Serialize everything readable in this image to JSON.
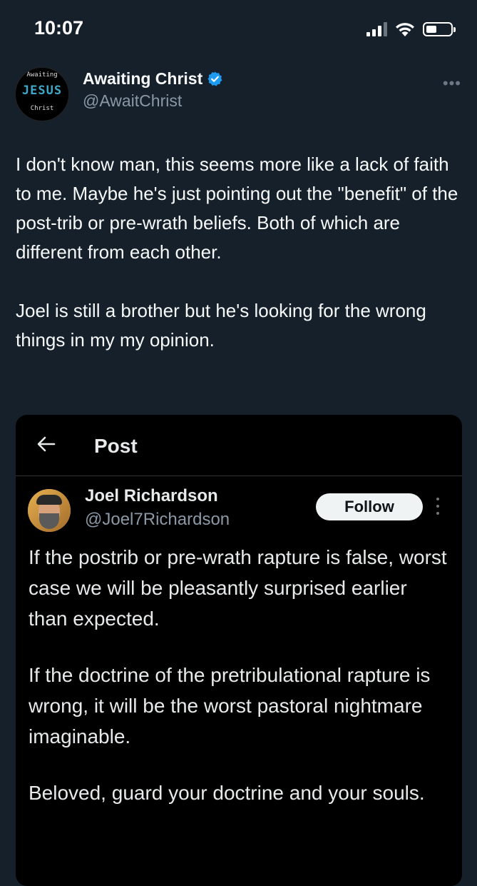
{
  "status_bar": {
    "time": "10:07"
  },
  "tweet": {
    "author_name": "Awaiting Christ",
    "author_handle": "@AwaitChrist",
    "avatar_text": {
      "top": "Awaiting",
      "middle": "JESUS",
      "bottom": "Christ"
    },
    "paragraphs": [
      "I don't know man, this seems more like a lack of faith to me. Maybe he's just pointing out the \"benefit\" of the post-trib or pre-wrath beliefs. Both of which are different from each other.",
      "Joel is still a brother but he's looking for the wrong things in my my opinion."
    ]
  },
  "embedded_screenshot": {
    "title": "Post",
    "author_name": "Joel Richardson",
    "author_handle": "@Joel7Richardson",
    "follow_label": "Follow",
    "paragraphs": [
      "If the postrib or pre-wrath rapture is false, worst case we will be pleasantly surprised earlier than expected.",
      "If the doctrine of the pretribulational rapture is wrong, it will be the worst pastoral nightmare imaginable.",
      "Beloved, guard your doctrine and your souls."
    ]
  },
  "icons": [
    "signal-icon",
    "wifi-icon",
    "battery-icon",
    "verified-badge-icon",
    "more-icon",
    "back-arrow-icon"
  ],
  "colors": {
    "background": "#15202b",
    "embed_background": "#000000",
    "verified": "#1d9bf0",
    "secondary_text": "#8b98a5"
  }
}
